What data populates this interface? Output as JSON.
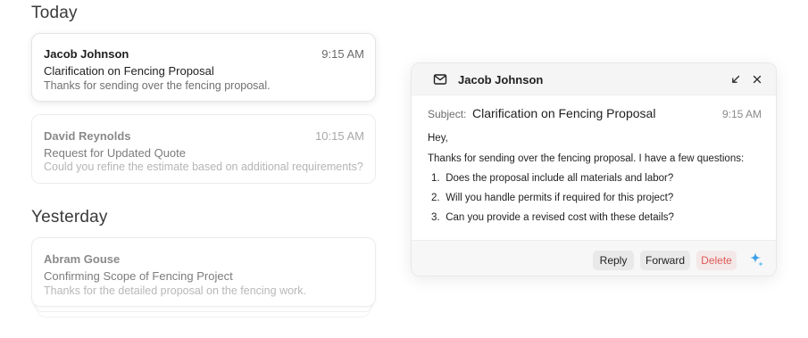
{
  "sections": {
    "today": "Today",
    "yesterday": "Yesterday"
  },
  "emails": [
    {
      "sender": "Jacob Johnson",
      "time": "9:15 AM",
      "subject": "Clarification on Fencing Proposal",
      "preview": "Thanks for sending over the fencing proposal."
    },
    {
      "sender": "David Reynolds",
      "time": "10:15 AM",
      "subject": "Request for Updated Quote",
      "preview": "Could you refine the estimate based on additional requirements?"
    },
    {
      "sender": "Abram Gouse",
      "time": "",
      "subject": "Confirming Scope of Fencing Project",
      "preview": "Thanks for the detailed proposal on the fencing work."
    }
  ],
  "detail": {
    "sender": "Jacob Johnson",
    "subject_label": "Subject:",
    "subject": "Clarification on Fencing Proposal",
    "time": "9:15 AM",
    "greeting": "Hey,",
    "intro": "Thanks for sending over the fencing proposal. I have a few questions:",
    "questions": [
      {
        "num": "1.",
        "text": "Does the proposal include all materials and labor?"
      },
      {
        "num": "2.",
        "text": "Will you handle permits if required for this project?"
      },
      {
        "num": "3.",
        "text": "Can you provide a revised cost with these details?"
      }
    ],
    "actions": {
      "reply": "Reply",
      "forward": "Forward",
      "delete": "Delete"
    }
  },
  "icons": {
    "header": "mail-icon",
    "minimize": "minimize-icon",
    "close": "close-icon",
    "assistant": "sparkle-icon"
  },
  "colors": {
    "delete_text": "#e05a5a",
    "delete_bg": "#f4e8e8",
    "sparkle": "#3aa0e8"
  }
}
